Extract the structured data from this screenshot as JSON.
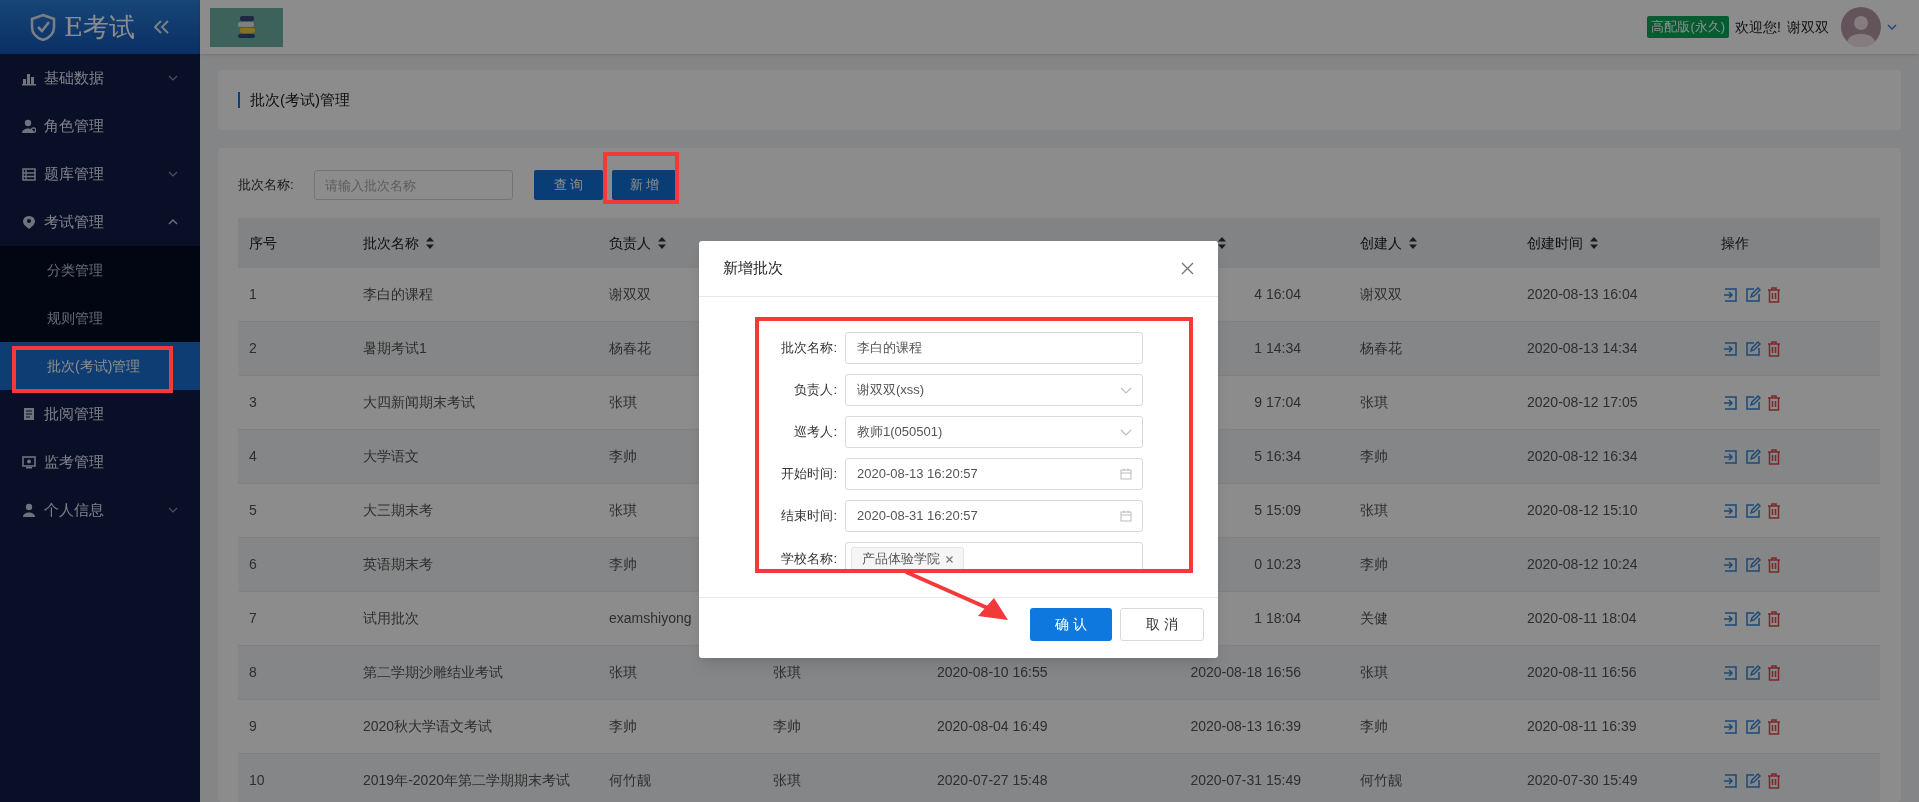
{
  "sidebar": {
    "logo_text": "E考试",
    "items": [
      {
        "label": "基础数据",
        "selected": false,
        "expanded": false
      },
      {
        "label": "角色管理",
        "selected": false
      },
      {
        "label": "题库管理",
        "selected": false,
        "expanded": false
      },
      {
        "label": "考试管理",
        "selected": false,
        "expanded": true,
        "children": [
          {
            "label": "分类管理",
            "selected": false,
            "highlighted": false
          },
          {
            "label": "规则管理",
            "selected": false,
            "highlighted": false
          },
          {
            "label": "批次(考试)管理",
            "selected": true,
            "highlighted": true
          }
        ]
      },
      {
        "label": "批阅管理",
        "selected": false
      },
      {
        "label": "监考管理",
        "selected": false
      },
      {
        "label": "个人信息",
        "selected": false,
        "expanded": false
      }
    ]
  },
  "header": {
    "badge": "高配版(永久)",
    "welcome": "欢迎您!",
    "user": "谢双双"
  },
  "page_title": "批次(考试)管理",
  "search": {
    "label": "批次名称:",
    "placeholder": "请输入批次名称",
    "query_button": "查 询",
    "add_button": "新 增",
    "add_highlighted": true
  },
  "table": {
    "columns": [
      {
        "label": "序号",
        "sortable": false
      },
      {
        "label": "批次名称",
        "sortable": true
      },
      {
        "label": "负责人",
        "sortable": true
      },
      {
        "kind": "covered"
      },
      {
        "kind": "covered"
      },
      {
        "kind": "covered",
        "sortable": true
      },
      {
        "label": "创建人",
        "sortable": true
      },
      {
        "label": "创建时间",
        "sortable": true
      },
      {
        "label": "操作",
        "sortable": false
      }
    ],
    "rows": [
      {
        "no": "1",
        "name": "李白的课程",
        "owner": "谢双双",
        "column_6": "4 16:04",
        "creator": "谢双双",
        "created": "2020-08-13 16:04"
      },
      {
        "no": "2",
        "name": "暑期考试1",
        "owner": "杨春花",
        "column_6": "1 14:34",
        "creator": "杨春花",
        "created": "2020-08-13 14:34"
      },
      {
        "no": "3",
        "name": "大四新闻期末考试",
        "owner": "张琪",
        "column_6": "9 17:04",
        "creator": "张琪",
        "created": "2020-08-12 17:05"
      },
      {
        "no": "4",
        "name": "大学语文",
        "owner": "李帅",
        "column_6": "5 16:34",
        "creator": "李帅",
        "created": "2020-08-12 16:34"
      },
      {
        "no": "5",
        "name": "大三期末考",
        "owner": "张琪",
        "column_6": "5 15:09",
        "creator": "张琪",
        "created": "2020-08-12 15:10"
      },
      {
        "no": "6",
        "name": "英语期末考",
        "owner": "李帅",
        "column_6": "0 10:23",
        "creator": "李帅",
        "created": "2020-08-12 10:24"
      },
      {
        "no": "7",
        "name": "试用批次",
        "owner": "examshiyong",
        "column_6": "1 18:04",
        "creator": "关健",
        "created": "2020-08-11 18:04"
      },
      {
        "no": "8",
        "name": "第二学期沙雕结业考试",
        "owner": "张琪",
        "column_4": "张琪",
        "column_5": "2020-08-10 16:55",
        "column_6": "2020-08-18 16:56",
        "creator": "张琪",
        "created": "2020-08-11 16:56"
      },
      {
        "no": "9",
        "name": "2020秋大学语文考试",
        "owner": "李帅",
        "column_4": "李帅",
        "column_5": "2020-08-04 16:49",
        "column_6": "2020-08-13 16:39",
        "creator": "李帅",
        "created": "2020-08-11 16:39"
      },
      {
        "no": "10",
        "name": "2019年-2020年第二学期期末考试",
        "owner": "何竹靓",
        "column_4": "张琪",
        "column_5": "2020-07-27 15:48",
        "column_6": "2020-07-31 15:49",
        "creator": "何竹靓",
        "created": "2020-07-30 15:49"
      }
    ]
  },
  "dialog": {
    "title": "新增批次",
    "fields": [
      {
        "label": "批次名称:",
        "kind": "text",
        "value": "李白的课程"
      },
      {
        "label": "负责人:",
        "kind": "select",
        "value": "谢双双(xss)"
      },
      {
        "label": "巡考人:",
        "kind": "select",
        "value": "教师1(050501)"
      },
      {
        "label": "开始时间:",
        "kind": "date",
        "value": "2020-08-13 16:20:57"
      },
      {
        "label": "结束时间:",
        "kind": "date",
        "value": "2020-08-31 16:20:57"
      },
      {
        "label": "学校名称:",
        "kind": "tags",
        "tags": [
          "产品体验学院"
        ]
      }
    ],
    "form_highlighted": true,
    "confirm_arrow": true,
    "confirm": "确 认",
    "cancel": "取 消"
  }
}
